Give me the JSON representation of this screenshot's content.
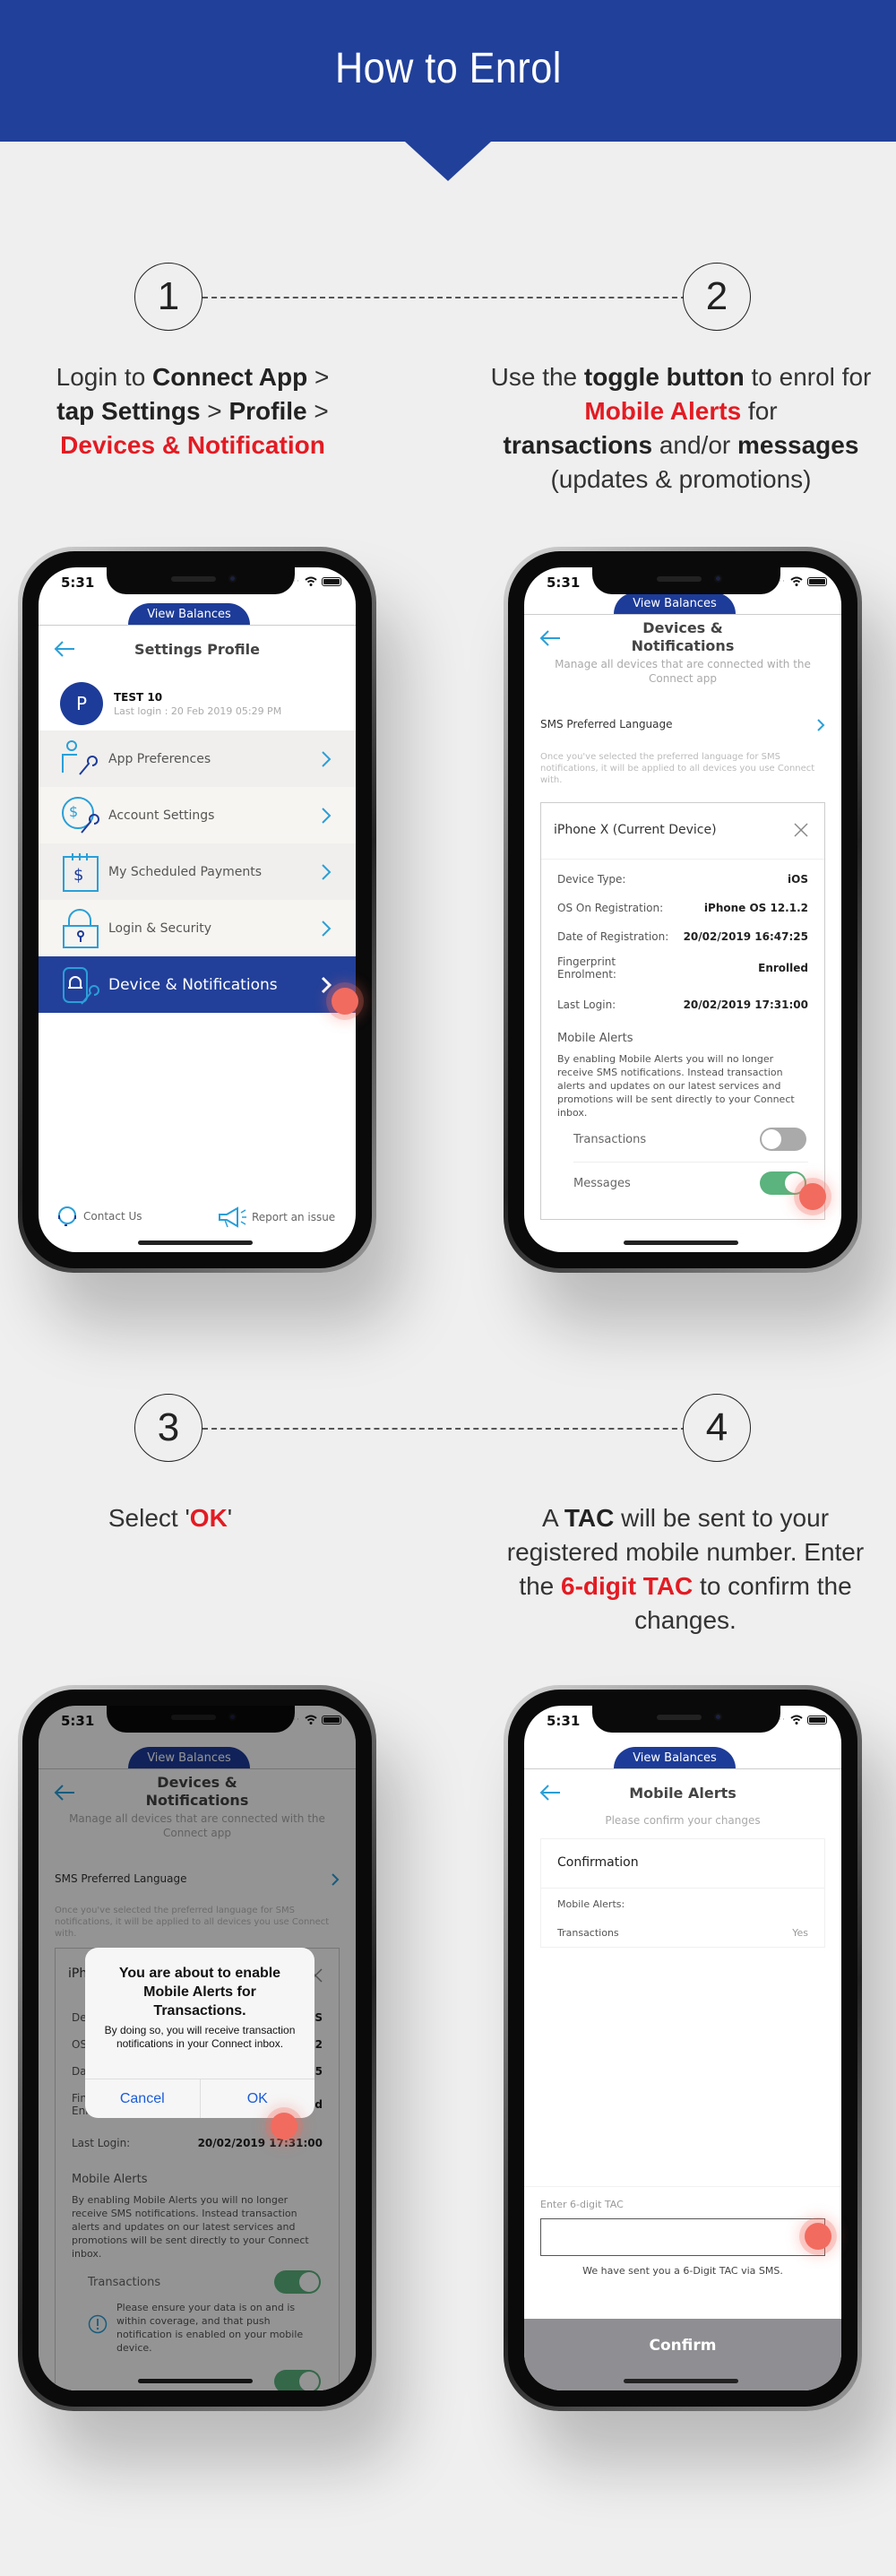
{
  "header": {
    "title": "How to Enrol"
  },
  "steps": [
    {
      "number": "1",
      "instruction": {
        "p1": "Login to ",
        "b1": "Connect App",
        "p2": " > ",
        "b2": "tap Settings",
        "p3": " > ",
        "b3": "Profile",
        "p4": " > ",
        "red": "Devices & Notification"
      }
    },
    {
      "number": "2",
      "instruction": {
        "p1": "Use the ",
        "b1": "toggle button",
        "p2": " to enrol for ",
        "red": "Mobile Alerts",
        "p3": " for ",
        "b2": "transactions",
        "p4": " and/or ",
        "b3": "messages",
        "p5": "(updates & promotions)"
      }
    },
    {
      "number": "3",
      "instruction": {
        "p1": "Select '",
        "red": "OK",
        "p2": "'"
      }
    },
    {
      "number": "4",
      "instruction": {
        "p1": "A ",
        "b1": "TAC",
        "p2": " will be sent to your registered mobile number. Enter the ",
        "red": "6-digit TAC",
        "p3": " to confirm the changes."
      }
    }
  ],
  "phone_common": {
    "time": "5:31",
    "view_balances": "View Balances"
  },
  "phone1": {
    "title": "Settings Profile",
    "user": {
      "initial": "P",
      "name": "TEST 10",
      "last_login": "Last login : 20 Feb 2019 05:29 PM"
    },
    "menu": [
      {
        "label": "App Preferences",
        "icon": "user-wrench-icon"
      },
      {
        "label": "Account Settings",
        "icon": "dollar-wrench-icon"
      },
      {
        "label": "My Scheduled Payments",
        "icon": "calendar-dollar-icon"
      },
      {
        "label": "Login & Security",
        "icon": "padlock-icon"
      },
      {
        "label": "Device & Notifications",
        "icon": "phone-bell-wrench-icon",
        "active": true
      }
    ],
    "footer": {
      "contact": "Contact Us",
      "report": "Report an issue"
    }
  },
  "devices_screen": {
    "title_line1": "Devices &",
    "title_line2": "Notifications",
    "subtitle": "Manage all devices that are connected with the Connect app",
    "sms_language": "SMS Preferred Language",
    "sms_note": "Once you've selected the preferred language for SMS notifications, it will be applied to all devices you use Connect with.",
    "device_card": {
      "title": "iPhone X (Current Device)",
      "rows": [
        {
          "label": "Device Type:",
          "value": "iOS"
        },
        {
          "label": "OS On Registration:",
          "value": "iPhone OS 12.1.2"
        },
        {
          "label": "Date of Registration:",
          "value": "20/02/2019 16:47:25"
        },
        {
          "label": "Fingerprint Enrolment:",
          "value": "Enrolled"
        },
        {
          "label": "Last Login:",
          "value": "20/02/2019 17:31:00"
        }
      ],
      "mobile_alerts_heading": "Mobile Alerts",
      "mobile_alerts_desc": "By enabling Mobile Alerts you will no longer receive SMS notifications. Instead transaction alerts and updates on our latest services and promotions will be sent directly to your Connect inbox.",
      "toggles": {
        "transactions_label": "Transactions",
        "messages_label": "Messages"
      }
    }
  },
  "phone2": {
    "transactions_on": false,
    "messages_on": true
  },
  "phone3": {
    "transactions_on": true,
    "info_note": "Please ensure your data is on and is within coverage, and that push notification is enabled on your mobile device.",
    "dialog": {
      "title": "You are about to enable Mobile Alerts for Transactions.",
      "message": "By doing so, you will receive transaction notifications in your Connect inbox.",
      "cancel": "Cancel",
      "ok": "OK"
    }
  },
  "phone4": {
    "title": "Mobile Alerts",
    "subtitle": "Please confirm your changes",
    "confirmation": {
      "heading": "Confirmation",
      "section": "Mobile Alerts:",
      "rows": [
        {
          "label": "Transactions",
          "value": "Yes"
        }
      ]
    },
    "tac_label": "Enter 6-digit TAC",
    "tac_value": "",
    "tac_note": "We have sent you a 6-Digit TAC via SMS.",
    "confirm_button": "Confirm"
  },
  "colors": {
    "brand_blue": "#21409a",
    "accent_red": "#e31b23",
    "link_blue": "#2a9fd8",
    "toggle_green": "#5bb37e",
    "tap_marker": "#f26b5f"
  }
}
